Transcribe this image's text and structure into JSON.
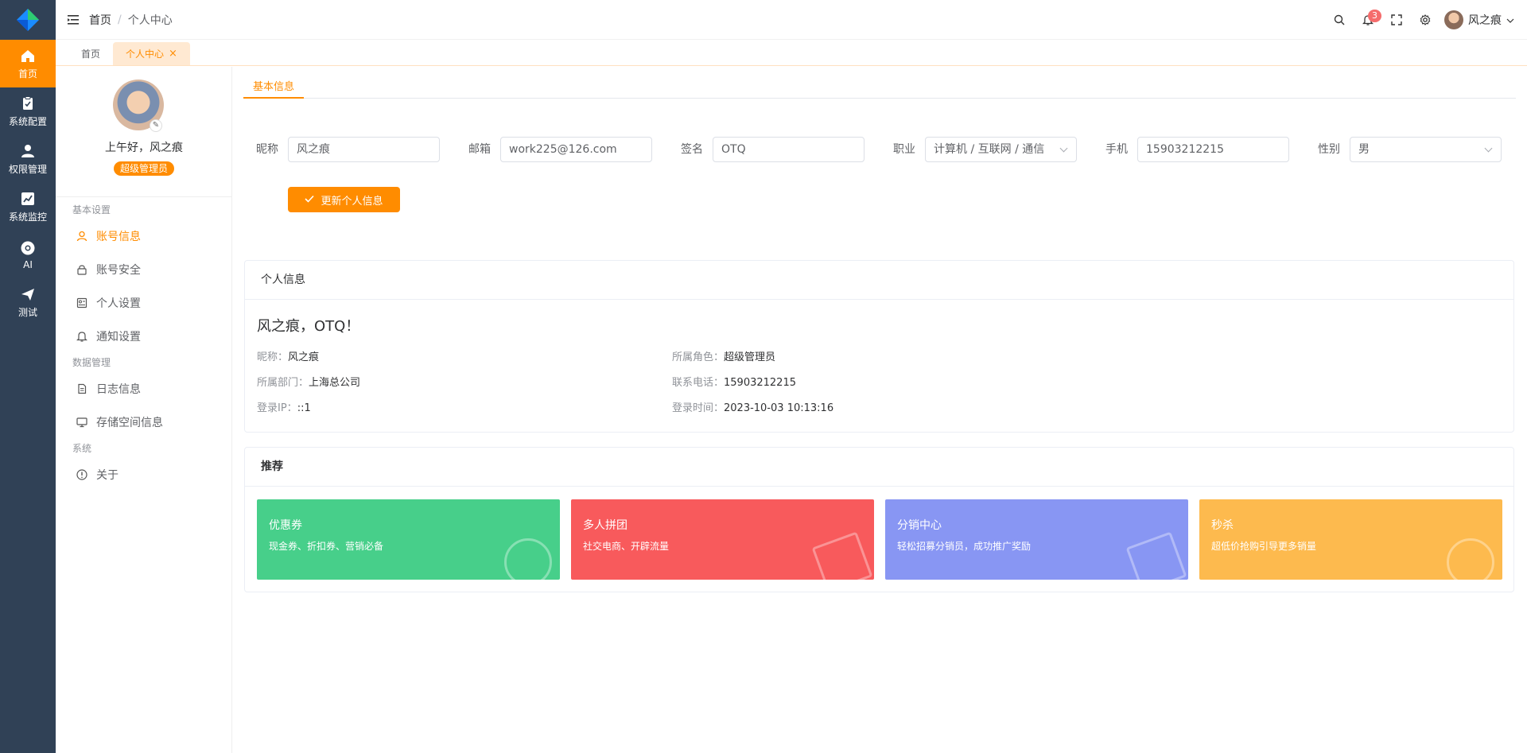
{
  "rail": [
    {
      "label": "首页",
      "icon": "home-icon",
      "active": true
    },
    {
      "label": "系统配置",
      "icon": "clipboard-icon"
    },
    {
      "label": "权限管理",
      "icon": "user-icon"
    },
    {
      "label": "系统监控",
      "icon": "chart-icon"
    },
    {
      "label": "AI",
      "icon": "chrome-icon"
    },
    {
      "label": "测试",
      "icon": "send-icon"
    }
  ],
  "breadcrumb": {
    "home": "首页",
    "sep": "/",
    "current": "个人中心"
  },
  "topbar": {
    "notif_count": "3",
    "user_name": "风之痕"
  },
  "tabs": [
    {
      "label": "首页"
    },
    {
      "label": "个人中心",
      "close": "×"
    }
  ],
  "profile": {
    "greeting": "上午好，风之痕",
    "role": "超级管理员",
    "edit_icon": "✎"
  },
  "menu": {
    "groups": [
      {
        "title": "基本设置",
        "items": [
          {
            "label": "账号信息",
            "icon": "user-outline-icon",
            "active": true
          },
          {
            "label": "账号安全",
            "icon": "lock-icon"
          },
          {
            "label": "个人设置",
            "icon": "profile-card-icon"
          },
          {
            "label": "通知设置",
            "icon": "bell-icon"
          }
        ]
      },
      {
        "title": "数据管理",
        "items": [
          {
            "label": "日志信息",
            "icon": "document-icon"
          },
          {
            "label": "存储空间信息",
            "icon": "monitor-icon"
          }
        ]
      },
      {
        "title": "系统",
        "items": [
          {
            "label": "关于",
            "icon": "info-icon"
          }
        ]
      }
    ]
  },
  "form": {
    "tab": "基本信息",
    "nickname_label": "昵称",
    "nickname": "风之痕",
    "email_label": "邮箱",
    "email": "work225@126.com",
    "sign_label": "签名",
    "sign": "OTQ",
    "job_label": "职业",
    "job": "计算机 / 互联网 / 通信",
    "phone_label": "手机",
    "phone": "15903212215",
    "gender_label": "性别",
    "gender": "男",
    "update_button": "更新个人信息"
  },
  "info": {
    "title": "个人信息",
    "hello": "风之痕，OTQ！",
    "nickname_k": "昵称：",
    "nickname_v": "风之痕",
    "role_k": "所属角色：",
    "role_v": "超级管理员",
    "dept_k": "所属部门：",
    "dept_v": "上海总公司",
    "phone_k": "联系电话：",
    "phone_v": "15903212215",
    "ip_k": "登录IP：",
    "ip_v": "::1",
    "time_k": "登录时间：",
    "time_v": "2023-10-03 10:13:16"
  },
  "recommend": {
    "title": "推荐",
    "cards": [
      {
        "title": "优惠券",
        "desc": "现金券、折扣券、营销必备",
        "color": "#47cf8a"
      },
      {
        "title": "多人拼团",
        "desc": "社交电商、开辟流量",
        "color": "#f85a5c"
      },
      {
        "title": "分销中心",
        "desc": "轻松招募分销员，成功推广奖励",
        "color": "#8896f3"
      },
      {
        "title": "秒杀",
        "desc": "超低价抢购引导更多销量",
        "color": "#fdba4e"
      }
    ]
  },
  "colors": {
    "accent": "#ff8c00",
    "rail_bg": "#304156"
  }
}
